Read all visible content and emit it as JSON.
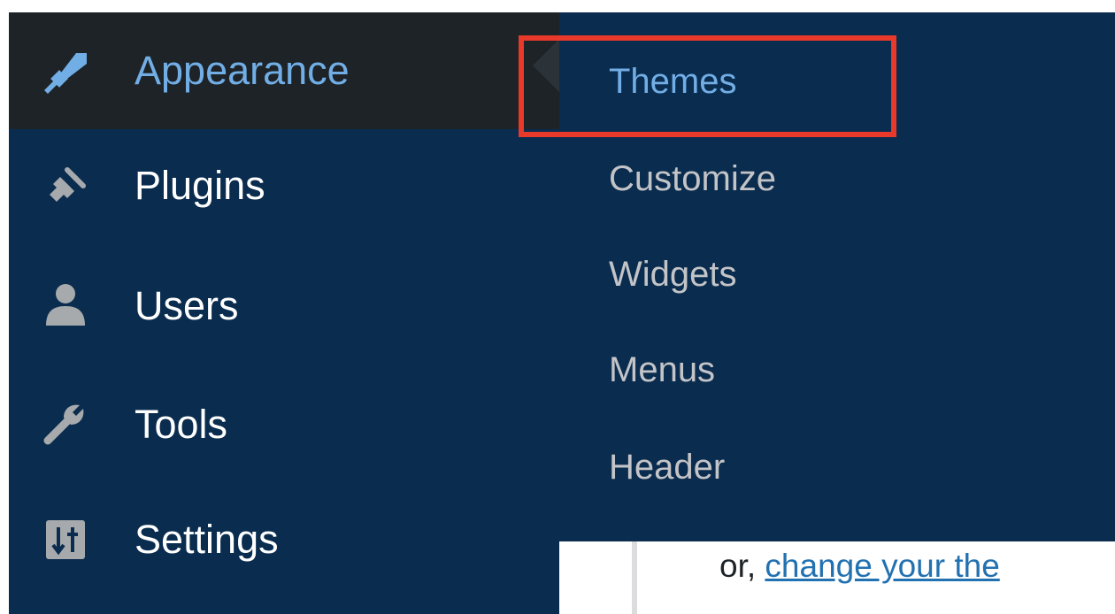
{
  "sidebar": {
    "items": [
      {
        "label": "Appearance",
        "icon": "paintbrush-icon",
        "active": true
      },
      {
        "label": "Plugins",
        "icon": "plug-icon"
      },
      {
        "label": "Users",
        "icon": "user-icon"
      },
      {
        "label": "Tools",
        "icon": "wrench-icon"
      },
      {
        "label": "Settings",
        "icon": "settings-sliders-icon"
      }
    ]
  },
  "flyout": {
    "items": [
      {
        "label": "Themes",
        "current": true
      },
      {
        "label": "Customize"
      },
      {
        "label": "Widgets"
      },
      {
        "label": "Menus"
      },
      {
        "label": "Header"
      }
    ]
  },
  "content": {
    "prefix": "or,",
    "link_text": "change your the"
  },
  "colors": {
    "sidebar_bg": "#0a2c4f",
    "active_bg": "#1d2327",
    "active_text": "#72aee6",
    "submenu_text": "#c3c4c7",
    "highlight": "#e8392b",
    "link": "#2271b1"
  }
}
